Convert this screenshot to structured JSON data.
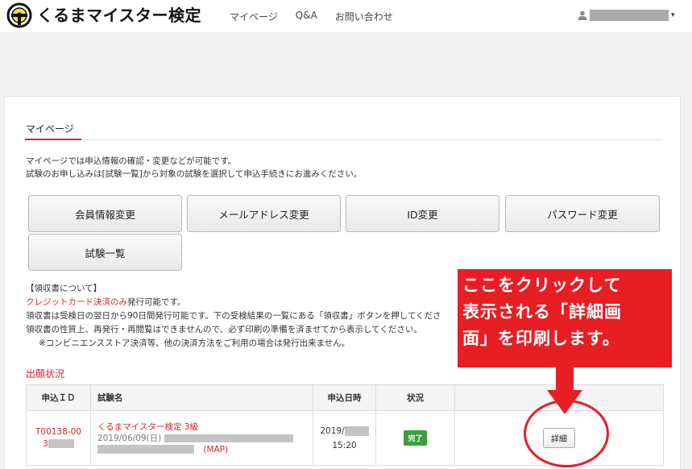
{
  "header": {
    "logo_text": "くるまマイスター検定",
    "nav": [
      "マイページ",
      "Q&A",
      "お問い合わせ"
    ],
    "user_caret": "▾"
  },
  "mypage": {
    "tab_title": "マイページ",
    "intro": [
      "マイページでは申込情報の確認・変更などが可能です。",
      "試験のお申し込みは[試験一覧]から対象の試験を選択して申込手続きにお進みください。"
    ],
    "buttons": {
      "member_info": "会員情報変更",
      "email": "メールアドレス変更",
      "id": "ID変更",
      "password": "パスワード変更",
      "exam_list": "試験一覧"
    }
  },
  "receipt": {
    "heading": "【領収書について】",
    "credit_only": "クレジットカード決済のみ",
    "credit_suffix": "発行可能です。",
    "line2": "領収書は受検日の翌日から90日間発行可能です。下の受検結果の一覧にある「領収書」ボタンを押してくださ",
    "line3": "領収書の性質上、再発行・再閲覧はできませんので、必ず印刷の準備を済ませてから表示してください。",
    "line4": "※コンビニエンスストア決済等、他の決済方法をご利用の場合は発行出来ません。"
  },
  "applications": {
    "section_title": "出願状況",
    "headers": [
      "申込ＩＤ",
      "試験名",
      "申込日時",
      "状況",
      ""
    ],
    "row": {
      "id_part1": "T00138-00",
      "id_part2": "3",
      "exam_name": "くるまマイスター検定 3級",
      "exam_date": "2019/06/09(日)",
      "map": "(MAP)",
      "date": "2019/",
      "time": "15:20",
      "status": "完了",
      "detail": "詳細"
    }
  },
  "annotation": {
    "lines": [
      "ここをクリックして",
      "表示される「詳細画",
      "面」を印刷します。"
    ]
  },
  "colors": {
    "accent": "#d9252b",
    "callout": "#e81e25",
    "badge": "#3aa03a"
  }
}
